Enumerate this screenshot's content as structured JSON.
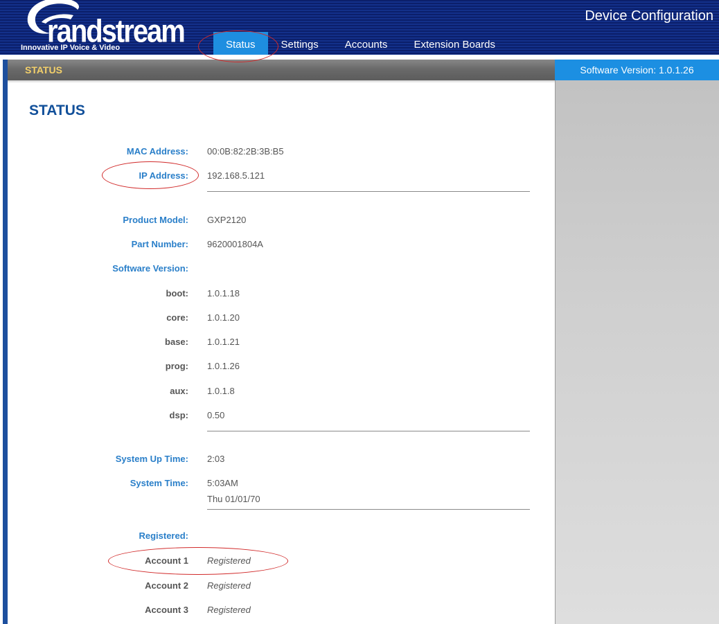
{
  "header": {
    "logo_word": "randstream",
    "logo_tagline": "Innovative IP Voice & Video",
    "device_title": "Device Configuration",
    "nav": [
      {
        "label": "Status",
        "active": true
      },
      {
        "label": "Settings",
        "active": false
      },
      {
        "label": "Accounts",
        "active": false
      },
      {
        "label": "Extension Boards",
        "active": false
      }
    ]
  },
  "subbar": {
    "section_label": "STATUS",
    "software_version": "Software Version: 1.0.1.26"
  },
  "main": {
    "title": "STATUS",
    "mac_address": {
      "label": "MAC Address:",
      "value": "00:0B:82:2B:3B:B5"
    },
    "ip_address": {
      "label": "IP Address:",
      "value": "192.168.5.121"
    },
    "product_model": {
      "label": "Product Model:",
      "value": "GXP2120"
    },
    "part_number": {
      "label": "Part Number:",
      "value": "9620001804A"
    },
    "software_version": {
      "label": "Software Version:",
      "items": [
        {
          "label": "boot:",
          "value": "1.0.1.18"
        },
        {
          "label": "core:",
          "value": "1.0.1.20"
        },
        {
          "label": "base:",
          "value": "1.0.1.21"
        },
        {
          "label": "prog:",
          "value": "1.0.1.26"
        },
        {
          "label": "aux:",
          "value": "1.0.1.8"
        },
        {
          "label": "dsp:",
          "value": "0.50"
        }
      ]
    },
    "system_up_time": {
      "label": "System Up Time:",
      "value": "2:03"
    },
    "system_time": {
      "label": "System Time:",
      "time": "5:03AM",
      "date": "Thu 01/01/70"
    },
    "registered": {
      "label": "Registered:",
      "accounts": [
        {
          "label": "Account 1",
          "value": "Registered"
        },
        {
          "label": "Account 2",
          "value": "Registered"
        },
        {
          "label": "Account 3",
          "value": "Registered"
        }
      ]
    }
  },
  "colors": {
    "header_blue": "#13308a",
    "accent_blue": "#1e8ee0",
    "label_blue": "#2a7fc9",
    "title_blue": "#12509a",
    "status_gold": "#f3d06a",
    "annotation_red": "#d12a2a"
  }
}
